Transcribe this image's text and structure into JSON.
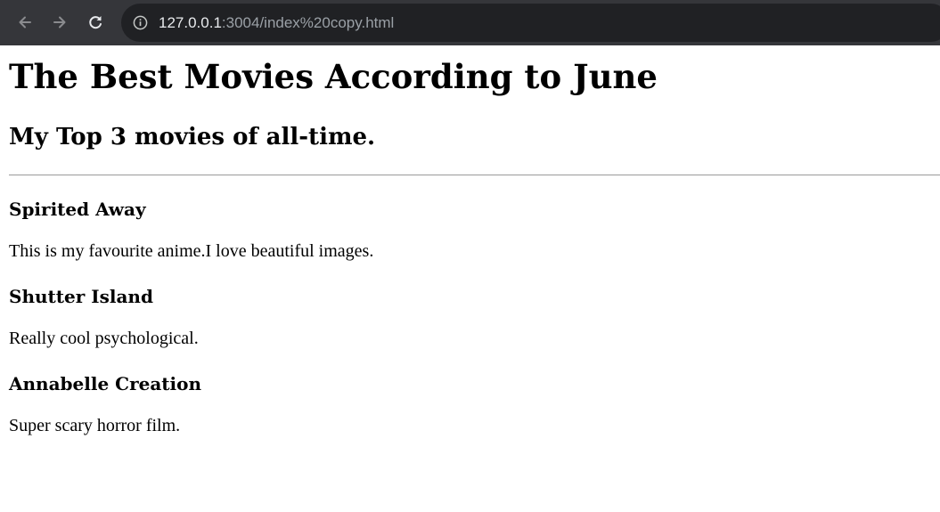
{
  "browser": {
    "url_host": "127.0.0.1",
    "url_path": ":3004/index%20copy.html"
  },
  "page": {
    "title": "The Best Movies According to June",
    "subtitle": "My Top 3 movies of all-time.",
    "movies": [
      {
        "title": "Spirited Away",
        "description": "This is my favourite anime.I love beautiful images."
      },
      {
        "title": "Shutter Island",
        "description": "Really cool psychological."
      },
      {
        "title": "Annabelle Creation",
        "description": "Super scary horror film."
      }
    ]
  }
}
